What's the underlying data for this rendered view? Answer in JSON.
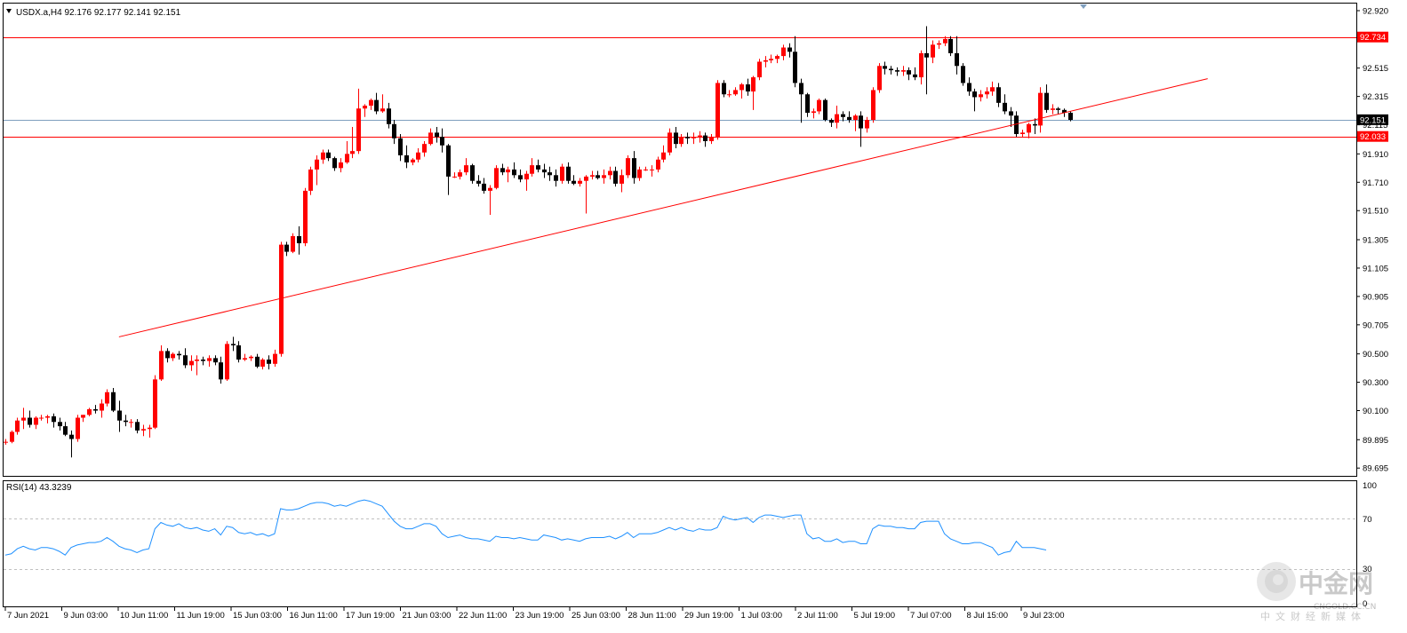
{
  "header": {
    "symbol_line": "USDX.a,H4  92.176 92.177 92.141 92.151"
  },
  "indicator": {
    "label": "RSI(14) 43.3239",
    "levels": [
      "100",
      "70",
      "30",
      "0"
    ]
  },
  "price_axis": {
    "ticks": [
      "92.920",
      "92.720",
      "92.515",
      "92.315",
      "92.115",
      "91.910",
      "91.710",
      "91.510",
      "91.305",
      "91.105",
      "90.905",
      "90.705",
      "90.500",
      "90.300",
      "90.100",
      "89.895",
      "89.695"
    ]
  },
  "price_tags": {
    "resistance": "92.734",
    "current": "92.151",
    "support": "92.033"
  },
  "time_axis": {
    "labels": [
      "7 Jun 2021",
      "9 Jun 03:00",
      "10 Jun 11:00",
      "11 Jun 19:00",
      "15 Jun 03:00",
      "16 Jun 11:00",
      "17 Jun 19:00",
      "21 Jun 03:00",
      "22 Jun 11:00",
      "23 Jun 19:00",
      "25 Jun 03:00",
      "28 Jun 11:00",
      "29 Jun 19:00",
      "1 Jul 03:00",
      "2 Jul 11:00",
      "5 Jul 19:00",
      "7 Jul 07:00",
      "8 Jul 15:00",
      "9 Jul 23:00"
    ]
  },
  "watermark": {
    "name": "中金网",
    "domain": "CNGOLD.CC.CN",
    "subtitle": "中文财经新媒体"
  },
  "colors": {
    "bull": "#ff0000",
    "bear": "#000000",
    "line": "#ff0000",
    "rsi": "#1e90ff",
    "current_price": "#7f9fbf",
    "grid_dash": "#c0c0c0"
  },
  "chart_data": {
    "type": "candlestick",
    "symbol": "USDX.a",
    "timeframe": "H4",
    "ylim": [
      89.64,
      92.97
    ],
    "horizontal_levels": [
      {
        "price": 92.734,
        "color": "red"
      },
      {
        "price": 92.033,
        "color": "red"
      },
      {
        "price": 92.151,
        "color": "steelblue"
      }
    ],
    "trendline": {
      "from": {
        "bar": 19,
        "price": 90.62
      },
      "to": {
        "bar": 201,
        "price": 92.44
      }
    },
    "candles": [
      [
        89.88,
        89.9,
        89.86,
        89.88
      ],
      [
        89.88,
        89.96,
        89.87,
        89.95
      ],
      [
        89.95,
        90.05,
        89.93,
        90.03
      ],
      [
        90.03,
        90.12,
        89.97,
        90.05
      ],
      [
        90.05,
        90.1,
        89.98,
        90.0
      ],
      [
        90.0,
        90.06,
        89.97,
        90.05
      ],
      [
        90.05,
        90.07,
        90.03,
        90.05
      ],
      [
        90.05,
        90.07,
        90.01,
        90.06
      ],
      [
        90.06,
        90.08,
        89.98,
        90.02
      ],
      [
        90.02,
        90.05,
        89.96,
        89.99
      ],
      [
        89.99,
        90.02,
        89.92,
        89.93
      ],
      [
        89.93,
        89.96,
        89.77,
        89.9
      ],
      [
        89.9,
        90.07,
        89.88,
        90.05
      ],
      [
        90.05,
        90.07,
        90.02,
        90.07
      ],
      [
        90.07,
        90.12,
        90.06,
        90.11
      ],
      [
        90.11,
        90.14,
        90.08,
        90.1
      ],
      [
        90.1,
        90.18,
        90.05,
        90.15
      ],
      [
        90.15,
        90.25,
        90.13,
        90.23
      ],
      [
        90.23,
        90.26,
        90.09,
        90.1
      ],
      [
        90.1,
        90.17,
        89.95,
        90.03
      ],
      [
        90.03,
        90.07,
        89.99,
        90.02
      ],
      [
        90.02,
        90.04,
        89.98,
        90.02
      ],
      [
        90.02,
        90.04,
        89.94,
        89.96
      ],
      [
        89.96,
        90.0,
        89.92,
        89.97
      ],
      [
        89.97,
        90.0,
        89.91,
        89.98
      ],
      [
        89.98,
        90.35,
        89.97,
        90.32
      ],
      [
        90.32,
        90.56,
        90.31,
        90.52
      ],
      [
        90.52,
        90.54,
        90.44,
        90.47
      ],
      [
        90.47,
        90.51,
        90.45,
        90.5
      ],
      [
        90.5,
        90.52,
        90.46,
        90.49
      ],
      [
        90.49,
        90.54,
        90.4,
        90.42
      ],
      [
        90.42,
        90.49,
        90.38,
        90.45
      ],
      [
        90.45,
        90.49,
        90.35,
        90.46
      ],
      [
        90.46,
        90.48,
        90.42,
        90.45
      ],
      [
        90.45,
        90.49,
        90.41,
        90.47
      ],
      [
        90.47,
        90.49,
        90.42,
        90.44
      ],
      [
        90.44,
        90.48,
        90.29,
        90.32
      ],
      [
        90.32,
        90.59,
        90.31,
        90.57
      ],
      [
        90.57,
        90.62,
        90.52,
        90.56
      ],
      [
        90.56,
        90.59,
        90.44,
        90.46
      ],
      [
        90.46,
        90.5,
        90.45,
        90.47
      ],
      [
        90.47,
        90.49,
        90.45,
        90.48
      ],
      [
        90.48,
        90.5,
        90.4,
        90.41
      ],
      [
        90.41,
        90.47,
        90.39,
        90.46
      ],
      [
        90.46,
        90.49,
        90.39,
        90.43
      ],
      [
        90.43,
        90.53,
        90.41,
        90.5
      ],
      [
        90.5,
        91.29,
        90.48,
        91.27
      ],
      [
        91.27,
        91.29,
        91.19,
        91.22
      ],
      [
        91.22,
        91.35,
        91.21,
        91.33
      ],
      [
        91.33,
        91.4,
        91.2,
        91.28
      ],
      [
        91.28,
        91.67,
        91.26,
        91.65
      ],
      [
        91.65,
        91.82,
        91.62,
        91.8
      ],
      [
        91.8,
        91.9,
        91.69,
        91.87
      ],
      [
        91.87,
        91.94,
        91.84,
        91.92
      ],
      [
        91.92,
        91.94,
        91.86,
        91.88
      ],
      [
        91.88,
        91.89,
        91.79,
        91.81
      ],
      [
        91.81,
        91.88,
        91.78,
        91.85
      ],
      [
        91.85,
        92.0,
        91.84,
        91.91
      ],
      [
        91.91,
        92.1,
        91.88,
        91.93
      ],
      [
        91.93,
        92.37,
        91.91,
        92.23
      ],
      [
        92.23,
        92.26,
        92.17,
        92.25
      ],
      [
        92.25,
        92.3,
        92.22,
        92.29
      ],
      [
        92.29,
        92.34,
        92.19,
        92.21
      ],
      [
        92.21,
        92.33,
        92.2,
        92.23
      ],
      [
        92.23,
        92.27,
        92.09,
        92.12
      ],
      [
        92.12,
        92.15,
        91.98,
        92.02
      ],
      [
        92.02,
        92.05,
        91.86,
        91.9
      ],
      [
        91.9,
        91.97,
        91.81,
        91.85
      ],
      [
        91.85,
        91.88,
        91.83,
        91.87
      ],
      [
        91.87,
        91.95,
        91.85,
        91.92
      ],
      [
        91.92,
        92.0,
        91.89,
        91.98
      ],
      [
        91.98,
        92.09,
        91.97,
        92.06
      ],
      [
        92.06,
        92.1,
        91.99,
        92.03
      ],
      [
        92.03,
        92.09,
        91.92,
        91.97
      ],
      [
        91.97,
        91.98,
        91.62,
        91.75
      ],
      [
        91.75,
        91.78,
        91.74,
        91.75
      ],
      [
        91.75,
        91.8,
        91.73,
        91.78
      ],
      [
        91.78,
        91.88,
        91.76,
        91.83
      ],
      [
        91.83,
        91.84,
        91.7,
        91.72
      ],
      [
        91.72,
        91.76,
        91.68,
        91.7
      ],
      [
        91.7,
        91.74,
        91.63,
        91.65
      ],
      [
        91.65,
        91.69,
        91.48,
        91.67
      ],
      [
        91.67,
        91.83,
        91.66,
        91.81
      ],
      [
        91.81,
        91.84,
        91.76,
        91.78
      ],
      [
        91.78,
        91.82,
        91.71,
        91.8
      ],
      [
        91.8,
        91.85,
        91.74,
        91.76
      ],
      [
        91.76,
        91.8,
        91.71,
        91.73
      ],
      [
        91.73,
        91.79,
        91.65,
        91.77
      ],
      [
        91.77,
        91.88,
        91.75,
        91.83
      ],
      [
        91.83,
        91.87,
        91.78,
        91.8
      ],
      [
        91.8,
        91.84,
        91.74,
        91.78
      ],
      [
        91.78,
        91.82,
        91.72,
        91.76
      ],
      [
        91.76,
        91.8,
        91.68,
        91.72
      ],
      [
        91.72,
        91.84,
        91.7,
        91.82
      ],
      [
        91.82,
        91.85,
        91.7,
        91.72
      ],
      [
        91.72,
        91.76,
        91.69,
        91.7
      ],
      [
        91.7,
        91.74,
        91.68,
        91.72
      ],
      [
        91.72,
        91.76,
        91.49,
        91.75
      ],
      [
        91.75,
        91.79,
        91.73,
        91.76
      ],
      [
        91.76,
        91.79,
        91.73,
        91.74
      ],
      [
        91.74,
        91.8,
        91.7,
        91.76
      ],
      [
        91.76,
        91.82,
        91.73,
        91.79
      ],
      [
        91.79,
        91.82,
        91.68,
        91.7
      ],
      [
        91.7,
        91.8,
        91.64,
        91.76
      ],
      [
        91.76,
        91.9,
        91.74,
        91.88
      ],
      [
        91.88,
        91.93,
        91.7,
        91.74
      ],
      [
        91.74,
        91.82,
        91.72,
        91.8
      ],
      [
        91.8,
        91.82,
        91.79,
        91.8
      ],
      [
        91.8,
        91.83,
        91.75,
        91.8
      ],
      [
        91.8,
        91.89,
        91.78,
        91.87
      ],
      [
        91.87,
        91.97,
        91.85,
        91.92
      ],
      [
        91.92,
        92.09,
        91.9,
        92.06
      ],
      [
        92.06,
        92.1,
        91.95,
        91.98
      ],
      [
        91.98,
        92.05,
        91.96,
        92.03
      ],
      [
        92.03,
        92.06,
        91.98,
        92.02
      ],
      [
        92.02,
        92.06,
        91.98,
        92.03
      ],
      [
        92.03,
        92.07,
        91.99,
        92.04
      ],
      [
        92.04,
        92.06,
        91.96,
        92.0
      ],
      [
        92.0,
        92.05,
        91.98,
        92.03
      ],
      [
        92.03,
        92.43,
        92.01,
        92.41
      ],
      [
        92.41,
        92.43,
        92.31,
        92.33
      ],
      [
        92.33,
        92.36,
        92.31,
        92.33
      ],
      [
        92.33,
        92.38,
        92.32,
        92.36
      ],
      [
        92.36,
        92.41,
        92.3,
        92.4
      ],
      [
        92.4,
        92.44,
        92.32,
        92.35
      ],
      [
        92.35,
        92.46,
        92.22,
        92.45
      ],
      [
        92.45,
        92.58,
        92.43,
        92.56
      ],
      [
        92.56,
        92.6,
        92.52,
        92.57
      ],
      [
        92.57,
        92.61,
        92.55,
        92.58
      ],
      [
        92.58,
        92.61,
        92.55,
        92.6
      ],
      [
        92.6,
        92.68,
        92.57,
        92.66
      ],
      [
        92.66,
        92.69,
        92.59,
        92.63
      ],
      [
        92.63,
        92.74,
        92.38,
        92.41
      ],
      [
        92.41,
        92.44,
        92.13,
        92.33
      ],
      [
        92.33,
        92.34,
        92.17,
        92.2
      ],
      [
        92.2,
        92.23,
        92.16,
        92.21
      ],
      [
        92.21,
        92.3,
        92.19,
        92.29
      ],
      [
        92.29,
        92.3,
        92.14,
        92.15
      ],
      [
        92.15,
        92.16,
        92.1,
        92.13
      ],
      [
        92.13,
        92.25,
        92.09,
        92.19
      ],
      [
        92.19,
        92.21,
        92.14,
        92.17
      ],
      [
        92.17,
        92.21,
        92.13,
        92.15
      ],
      [
        92.15,
        92.19,
        92.07,
        92.18
      ],
      [
        92.18,
        92.21,
        91.96,
        92.09
      ],
      [
        92.09,
        92.17,
        92.06,
        92.15
      ],
      [
        92.15,
        92.38,
        92.13,
        92.36
      ],
      [
        92.36,
        92.55,
        92.34,
        92.53
      ],
      [
        92.53,
        92.56,
        92.47,
        92.51
      ],
      [
        92.51,
        92.53,
        92.47,
        92.5
      ],
      [
        92.5,
        92.52,
        92.46,
        92.49
      ],
      [
        92.49,
        92.53,
        92.46,
        92.5
      ],
      [
        92.5,
        92.52,
        92.43,
        92.47
      ],
      [
        92.47,
        92.52,
        92.43,
        92.45
      ],
      [
        92.45,
        92.64,
        92.4,
        92.62
      ],
      [
        92.62,
        92.81,
        92.33,
        92.59
      ],
      [
        92.59,
        92.71,
        92.55,
        92.68
      ],
      [
        92.68,
        92.71,
        92.65,
        92.69
      ],
      [
        92.69,
        92.74,
        92.67,
        92.72
      ],
      [
        92.72,
        92.74,
        92.6,
        92.62
      ],
      [
        92.62,
        92.74,
        92.47,
        92.53
      ],
      [
        92.53,
        92.55,
        92.39,
        92.41
      ],
      [
        92.41,
        92.45,
        92.32,
        92.35
      ],
      [
        92.35,
        92.37,
        92.21,
        92.31
      ],
      [
        92.31,
        92.36,
        92.28,
        92.33
      ],
      [
        92.33,
        92.38,
        92.3,
        92.35
      ],
      [
        92.35,
        92.42,
        92.32,
        92.38
      ],
      [
        92.38,
        92.41,
        92.24,
        92.27
      ],
      [
        92.27,
        92.33,
        92.19,
        92.21
      ],
      [
        92.21,
        92.24,
        92.1,
        92.18
      ],
      [
        92.18,
        92.21,
        92.03,
        92.05
      ],
      [
        92.05,
        92.08,
        92.03,
        92.06
      ],
      [
        92.06,
        92.13,
        92.02,
        92.12
      ],
      [
        92.12,
        92.16,
        92.05,
        92.11
      ],
      [
        92.11,
        92.38,
        92.06,
        92.34
      ],
      [
        92.34,
        92.4,
        92.2,
        92.22
      ],
      [
        92.22,
        92.26,
        92.19,
        92.23
      ],
      [
        92.23,
        92.24,
        92.19,
        92.22
      ],
      [
        92.22,
        92.23,
        92.17,
        92.2
      ],
      [
        92.2,
        92.21,
        92.14,
        92.15
      ]
    ],
    "rsi": {
      "name": "RSI(14)",
      "last": 43.3239,
      "range": [
        0,
        100
      ],
      "levels": [
        70,
        30
      ],
      "values": [
        41,
        42,
        46,
        48,
        46,
        45,
        47,
        47,
        46,
        44,
        41,
        47,
        49,
        50,
        51,
        51,
        52,
        55,
        52,
        48,
        46,
        45,
        43,
        45,
        46,
        62,
        67,
        65,
        64,
        66,
        63,
        62,
        63,
        61,
        60,
        62,
        57,
        64,
        63,
        59,
        58,
        59,
        57,
        58,
        56,
        58,
        78,
        77,
        77,
        78,
        80,
        82,
        83,
        83,
        82,
        80,
        81,
        80,
        82,
        84,
        85,
        84,
        82,
        80,
        74,
        68,
        64,
        62,
        62,
        64,
        66,
        66,
        64,
        58,
        55,
        56,
        57,
        55,
        54,
        54,
        53,
        52,
        56,
        55,
        55,
        54,
        55,
        54,
        53,
        53,
        57,
        56,
        55,
        53,
        54,
        53,
        52,
        54,
        55,
        55,
        55,
        56,
        54,
        56,
        59,
        55,
        58,
        58,
        58,
        59,
        61,
        63,
        61,
        63,
        61,
        60,
        62,
        61,
        61,
        63,
        72,
        70,
        69,
        70,
        71,
        67,
        71,
        73,
        73,
        72,
        71,
        72,
        73,
        73,
        58,
        54,
        55,
        52,
        52,
        54,
        51,
        52,
        52,
        50,
        50,
        62,
        65,
        64,
        64,
        63,
        63,
        62,
        62,
        67,
        68,
        68,
        68,
        58,
        54,
        52,
        50,
        50,
        51,
        51,
        49,
        47,
        41,
        43,
        44,
        52,
        47,
        47,
        47,
        46,
        45
      ]
    }
  }
}
